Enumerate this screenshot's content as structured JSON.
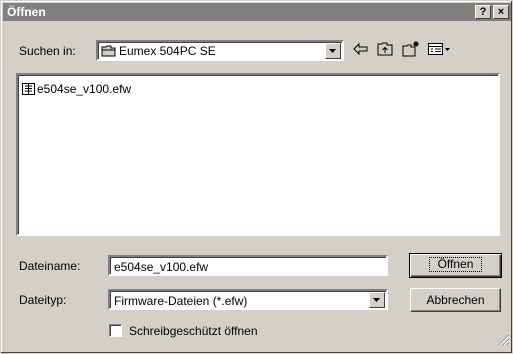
{
  "window": {
    "title": "Öffnen",
    "help_label": "?",
    "close_label": "×"
  },
  "toolbar": {
    "look_in_label": "Suchen in:",
    "look_in_value": "Eumex 504PC SE"
  },
  "files": [
    {
      "name": "e504se_v100.efw",
      "icon": "firmware-file-icon"
    }
  ],
  "form": {
    "filename_label": "Dateiname:",
    "filename_value": "e504se_v100.efw",
    "filetype_label": "Dateityp:",
    "filetype_value": "Firmware-Dateien (*.efw)",
    "readonly_label": "Schreibgeschützt öffnen",
    "readonly_checked": false
  },
  "buttons": {
    "open_label": "Öffnen",
    "cancel_label": "Abbrechen"
  },
  "icons": {
    "folder": "folder-icon",
    "back": "back-arrow-icon",
    "up": "up-folder-icon",
    "new_folder": "new-folder-icon",
    "view_menu": "view-menu-icon"
  },
  "colors": {
    "dialog_bg": "#d4d0c8",
    "titlebar_inactive": "#808080",
    "field_bg": "#ffffff"
  }
}
